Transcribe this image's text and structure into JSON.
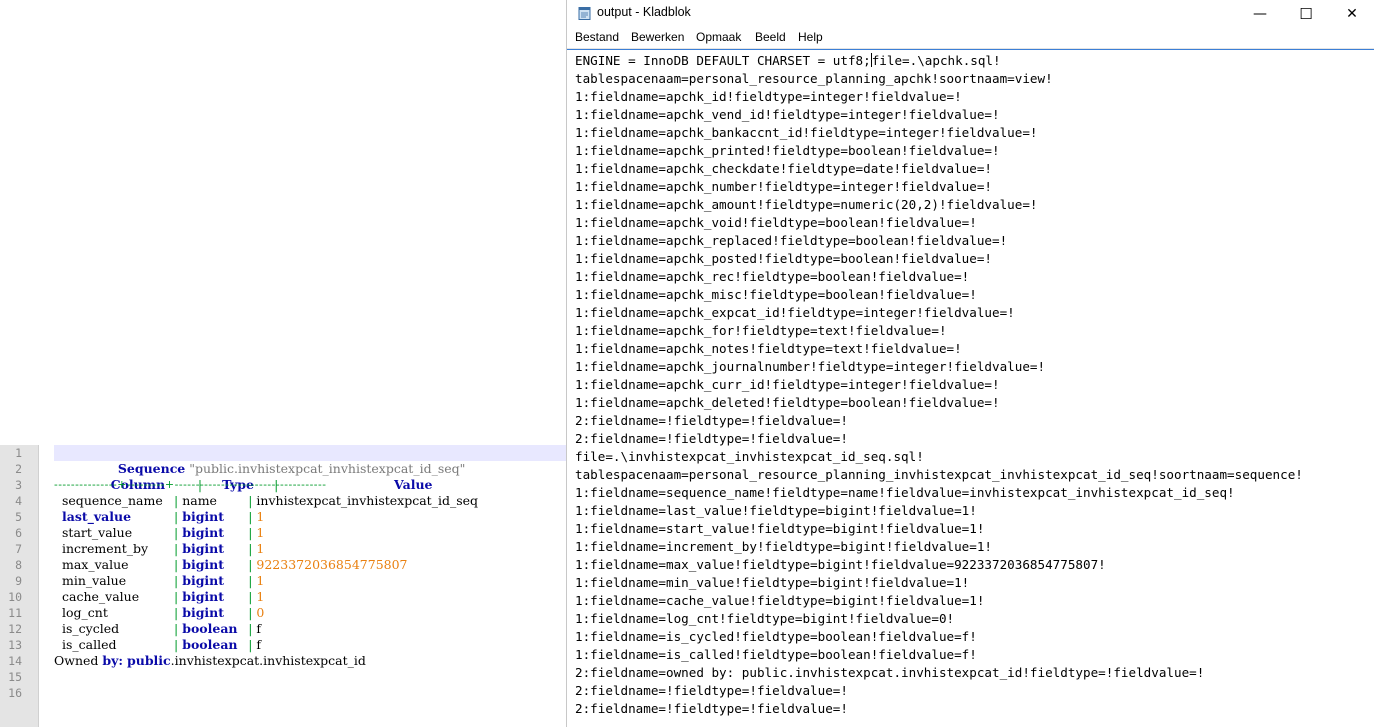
{
  "editor": {
    "line_numbers": [
      "1",
      "2",
      "3",
      "4",
      "5",
      "6",
      "7",
      "8",
      "9",
      "10",
      "11",
      "12",
      "13",
      "14",
      "15",
      "16"
    ],
    "header": {
      "keyword": "Sequence",
      "name": "\"public.invhistexpcat_invhistexpcat_id_seq\"",
      "col_column": "Column",
      "col_type": "Type",
      "col_value": "Value",
      "separator": "---------------+---------+------------------------------------"
    },
    "rows": [
      {
        "column": "sequence_name",
        "type": "name",
        "value": "invhistexpcat_invhistexpcat_id_seq"
      },
      {
        "column": "last_value",
        "type": "bigint",
        "value": "1"
      },
      {
        "column": "start_value",
        "type": "bigint",
        "value": "1"
      },
      {
        "column": "increment_by",
        "type": "bigint",
        "value": "1"
      },
      {
        "column": "max_value",
        "type": "bigint",
        "value": "9223372036854775807"
      },
      {
        "column": "min_value",
        "type": "bigint",
        "value": "1"
      },
      {
        "column": "cache_value",
        "type": "bigint",
        "value": "1"
      },
      {
        "column": "log_cnt",
        "type": "bigint",
        "value": "0"
      },
      {
        "column": "is_cycled",
        "type": "boolean",
        "value": "f"
      },
      {
        "column": "is_called",
        "type": "boolean",
        "value": "f"
      }
    ],
    "owned": {
      "label_plain": "Owned ",
      "label_kw": "by:",
      "schema": "public",
      "rest": ".invhistexpcat.invhistexpcat_id"
    }
  },
  "notepad": {
    "title": "output - Kladblok",
    "window_controls": {
      "minimize": "—",
      "maximize": "☐",
      "close": "✕"
    },
    "menu": [
      "Bestand",
      "Bewerken",
      "Opmaak",
      "Beeld",
      "Help"
    ],
    "first_line_before_caret": "ENGINE = InnoDB DEFAULT CHARSET = utf8;",
    "first_line_after_caret": "file=.\\apchk.sql!",
    "lines": [
      "tablespacenaam=personal_resource_planning_apchk!soortnaam=view!",
      "1:fieldname=apchk_id!fieldtype=integer!fieldvalue=!",
      "1:fieldname=apchk_vend_id!fieldtype=integer!fieldvalue=!",
      "1:fieldname=apchk_bankaccnt_id!fieldtype=integer!fieldvalue=!",
      "1:fieldname=apchk_printed!fieldtype=boolean!fieldvalue=!",
      "1:fieldname=apchk_checkdate!fieldtype=date!fieldvalue=!",
      "1:fieldname=apchk_number!fieldtype=integer!fieldvalue=!",
      "1:fieldname=apchk_amount!fieldtype=numeric(20,2)!fieldvalue=!",
      "1:fieldname=apchk_void!fieldtype=boolean!fieldvalue=!",
      "1:fieldname=apchk_replaced!fieldtype=boolean!fieldvalue=!",
      "1:fieldname=apchk_posted!fieldtype=boolean!fieldvalue=!",
      "1:fieldname=apchk_rec!fieldtype=boolean!fieldvalue=!",
      "1:fieldname=apchk_misc!fieldtype=boolean!fieldvalue=!",
      "1:fieldname=apchk_expcat_id!fieldtype=integer!fieldvalue=!",
      "1:fieldname=apchk_for!fieldtype=text!fieldvalue=!",
      "1:fieldname=apchk_notes!fieldtype=text!fieldvalue=!",
      "1:fieldname=apchk_journalnumber!fieldtype=integer!fieldvalue=!",
      "1:fieldname=apchk_curr_id!fieldtype=integer!fieldvalue=!",
      "1:fieldname=apchk_deleted!fieldtype=boolean!fieldvalue=!",
      "2:fieldname=!fieldtype=!fieldvalue=!",
      "2:fieldname=!fieldtype=!fieldvalue=!",
      "file=.\\invhistexpcat_invhistexpcat_id_seq.sql!",
      "tablespacenaam=personal_resource_planning_invhistexpcat_invhistexpcat_id_seq!soortnaam=sequence!",
      "1:fieldname=sequence_name!fieldtype=name!fieldvalue=invhistexpcat_invhistexpcat_id_seq!",
      "1:fieldname=last_value!fieldtype=bigint!fieldvalue=1!",
      "1:fieldname=start_value!fieldtype=bigint!fieldvalue=1!",
      "1:fieldname=increment_by!fieldtype=bigint!fieldvalue=1!",
      "1:fieldname=max_value!fieldtype=bigint!fieldvalue=9223372036854775807!",
      "1:fieldname=min_value!fieldtype=bigint!fieldvalue=1!",
      "1:fieldname=cache_value!fieldtype=bigint!fieldvalue=1!",
      "1:fieldname=log_cnt!fieldtype=bigint!fieldvalue=0!",
      "1:fieldname=is_cycled!fieldtype=boolean!fieldvalue=f!",
      "1:fieldname=is_called!fieldtype=boolean!fieldvalue=f!",
      "2:fieldname=owned by: public.invhistexpcat.invhistexpcat_id!fieldtype=!fieldvalue=!",
      "2:fieldname=!fieldtype=!fieldvalue=!",
      "2:fieldname=!fieldtype=!fieldvalue=!"
    ]
  }
}
